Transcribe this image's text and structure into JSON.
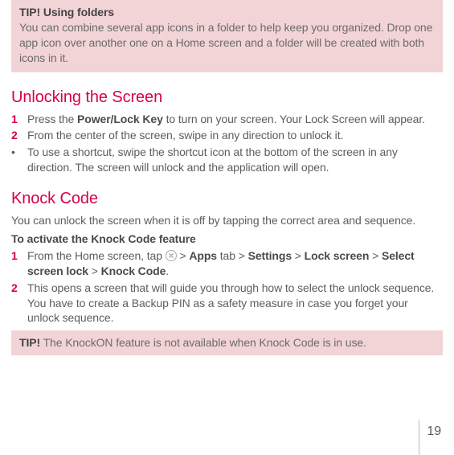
{
  "tip1": {
    "title": "TIP! Using folders",
    "body": "You can combine several app icons in a folder to help keep you organized. Drop one app icon over another one on a Home screen and a folder will be created with both icons in it."
  },
  "unlocking": {
    "heading": "Unlocking the Screen",
    "items": [
      {
        "num": "1",
        "pre": "Press the ",
        "bold": "Power/Lock Key",
        "post": " to turn on your screen. Your Lock Screen will appear."
      },
      {
        "num": "2",
        "text": "From the center of the screen, swipe in any direction to unlock it."
      },
      {
        "bullet": "•",
        "text": "To use a shortcut, swipe the shortcut icon at the bottom of the screen in any direction. The screen will unlock and the application will open."
      }
    ]
  },
  "knock": {
    "heading": "Knock Code",
    "intro": "You can unlock the screen when it is off by tapping the correct area and sequence.",
    "subhead": "To activate the Knock Code feature",
    "items": [
      {
        "num": "1",
        "parts": {
          "pre": "From the Home screen, tap ",
          "gt": " > ",
          "apps": "Apps",
          "tab": " tab > ",
          "settings": "Settings",
          "gt2": " > ",
          "lockscreen": "Lock screen",
          "gt3": " > ",
          "select": "Select screen lock",
          "gt4": " > ",
          "knockcode": "Knock Code",
          "dot": "."
        }
      },
      {
        "num": "2",
        "text": "This opens a screen that will guide you through how to select the unlock sequence. You have to create a Backup PIN as a safety measure in case you forget your unlock sequence."
      }
    ]
  },
  "tip2": {
    "title": "TIP!",
    "body": " The KnockON feature is not available when Knock Code is in use."
  },
  "page": "19"
}
